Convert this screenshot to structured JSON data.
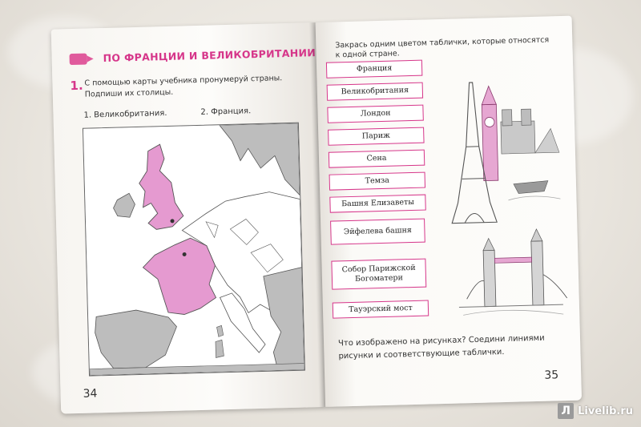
{
  "left_page": {
    "title": "ПО ФРАНЦИИ И ВЕЛИКОБРИТАНИИ",
    "task_number": "1.",
    "task_text": "С помощью карты учебника пронумеруй страны. Подпиши их столицы.",
    "answers": [
      "1. Великобритания.",
      "2. Франция."
    ],
    "page_number": "34"
  },
  "right_page": {
    "instruction": "Закрась одним цветом таблички, которые относятся к одной стране.",
    "tags": [
      "Франция",
      "Великобритания",
      "Лондон",
      "Париж",
      "Сена",
      "Темза",
      "Башня Елизаветы",
      "Эйфелева башня",
      "Собор Парижской Богоматери",
      "Тауэрский мост"
    ],
    "question": "Что изображено на рисунках? Соедини линиями рисунки и соответствующие таблички.",
    "page_number": "35"
  },
  "watermark": {
    "logo": "Л",
    "text": "Livelib.ru"
  },
  "colors": {
    "accent": "#d6368a",
    "map_pink": "#e59ad0",
    "map_gray": "#bdbdbd"
  }
}
